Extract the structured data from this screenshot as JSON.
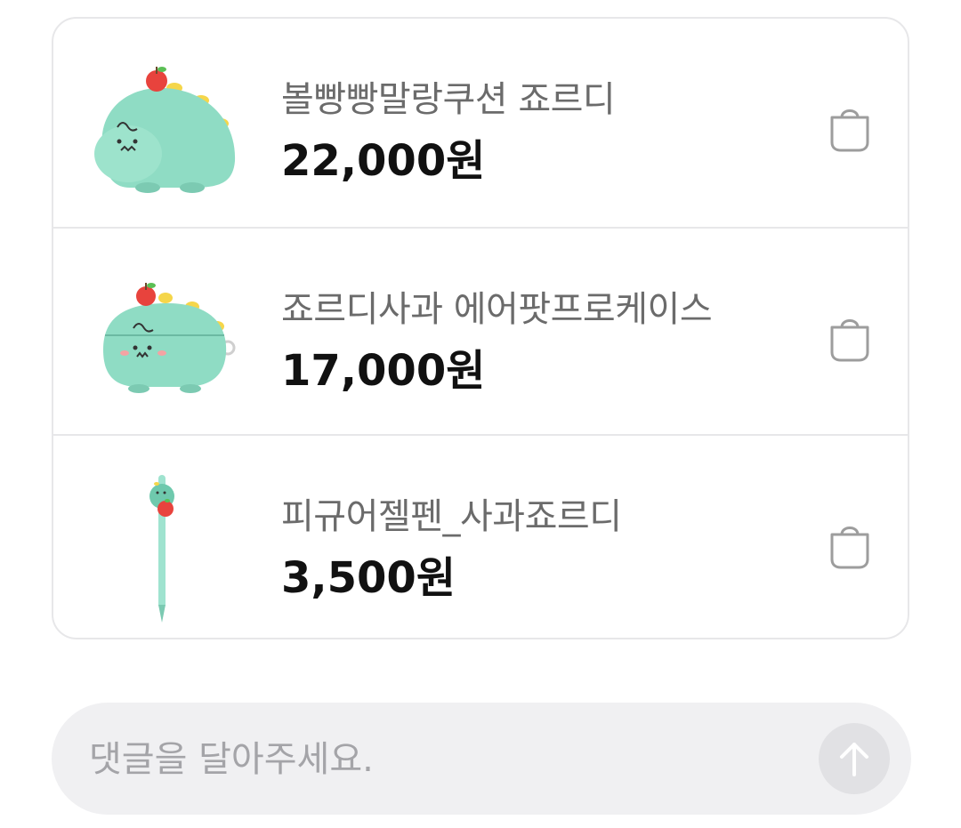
{
  "products": [
    {
      "name": "볼빵빵말랑쿠션 죠르디",
      "price": "22,000원",
      "image": "jordy-cushion-image",
      "action_icon": "shopping-bag-icon"
    },
    {
      "name": "죠르디사과 에어팟프로케이스",
      "price": "17,000원",
      "image": "jordy-airpods-case-image",
      "action_icon": "shopping-bag-icon"
    },
    {
      "name": "피규어젤펜_사과죠르디",
      "price": "3,500원",
      "image": "jordy-gel-pen-image",
      "action_icon": "shopping-bag-icon"
    }
  ],
  "comment": {
    "placeholder": "댓글을 달아주세요.",
    "value": "",
    "send_icon": "arrow-up-icon"
  },
  "colors": {
    "jordy_green": "#8fdcc4",
    "apple_red": "#e8433d",
    "bag_icon_gray": "#9d9d9d",
    "send_button_bg": "#e1e1e4"
  }
}
